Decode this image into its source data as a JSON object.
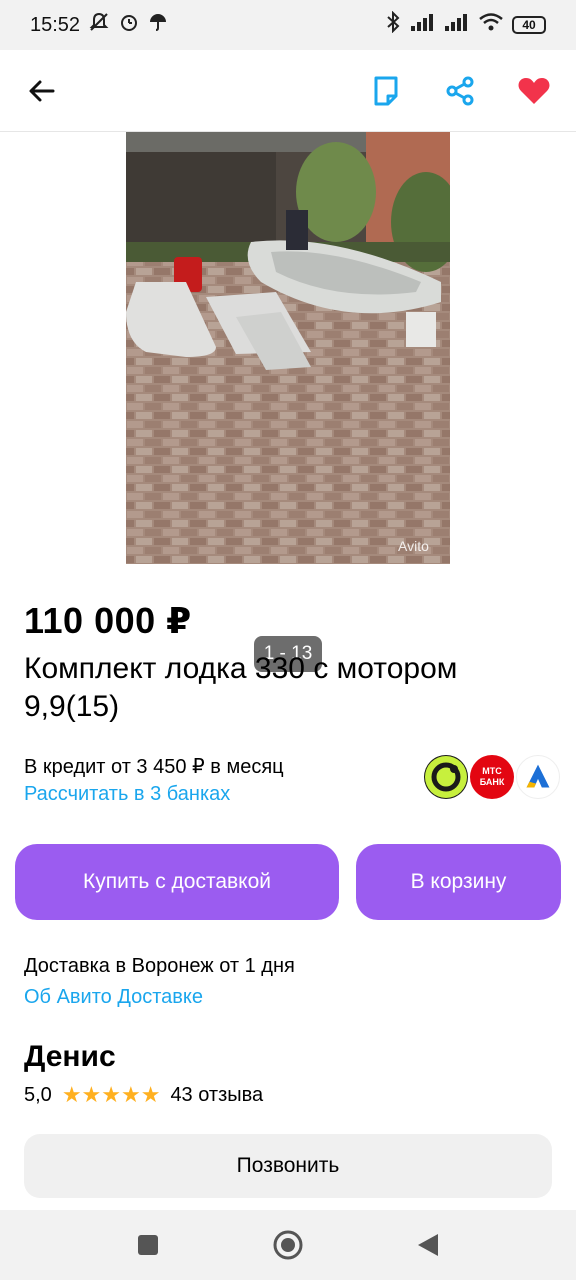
{
  "status_bar": {
    "time": "15:52",
    "battery": "40"
  },
  "app_bar": {
    "back_icon": "arrow-left-icon",
    "note_icon": "note-icon",
    "share_icon": "share-icon",
    "favorite_icon": "heart-icon"
  },
  "gallery": {
    "counter": "1 - 13",
    "watermark": "Avito"
  },
  "listing": {
    "price": "110 000 ₽",
    "title": "Комплект лодка 330 с мотором 9,9(15)"
  },
  "credit": {
    "text": "В кредит от 3 450 ₽ в месяц",
    "link": "Рассчитать в 3 банках",
    "banks": [
      "МТС БАНК"
    ]
  },
  "buttons": {
    "buy_delivery": "Купить с доставкой",
    "cart": "В корзину",
    "call": "Позвонить"
  },
  "delivery": {
    "text": "Доставка в Воронеж от 1 дня",
    "link": "Об Авито Доставке"
  },
  "seller": {
    "name": "Денис",
    "rating": "5,0",
    "stars": "★★★★★",
    "reviews": "43 отзыва"
  },
  "colors": {
    "accent": "#9b5cf0",
    "link": "#1aa6ed",
    "favorite": "#f2334b",
    "icon_blue": "#1aa6ed",
    "star": "#ffb020"
  }
}
